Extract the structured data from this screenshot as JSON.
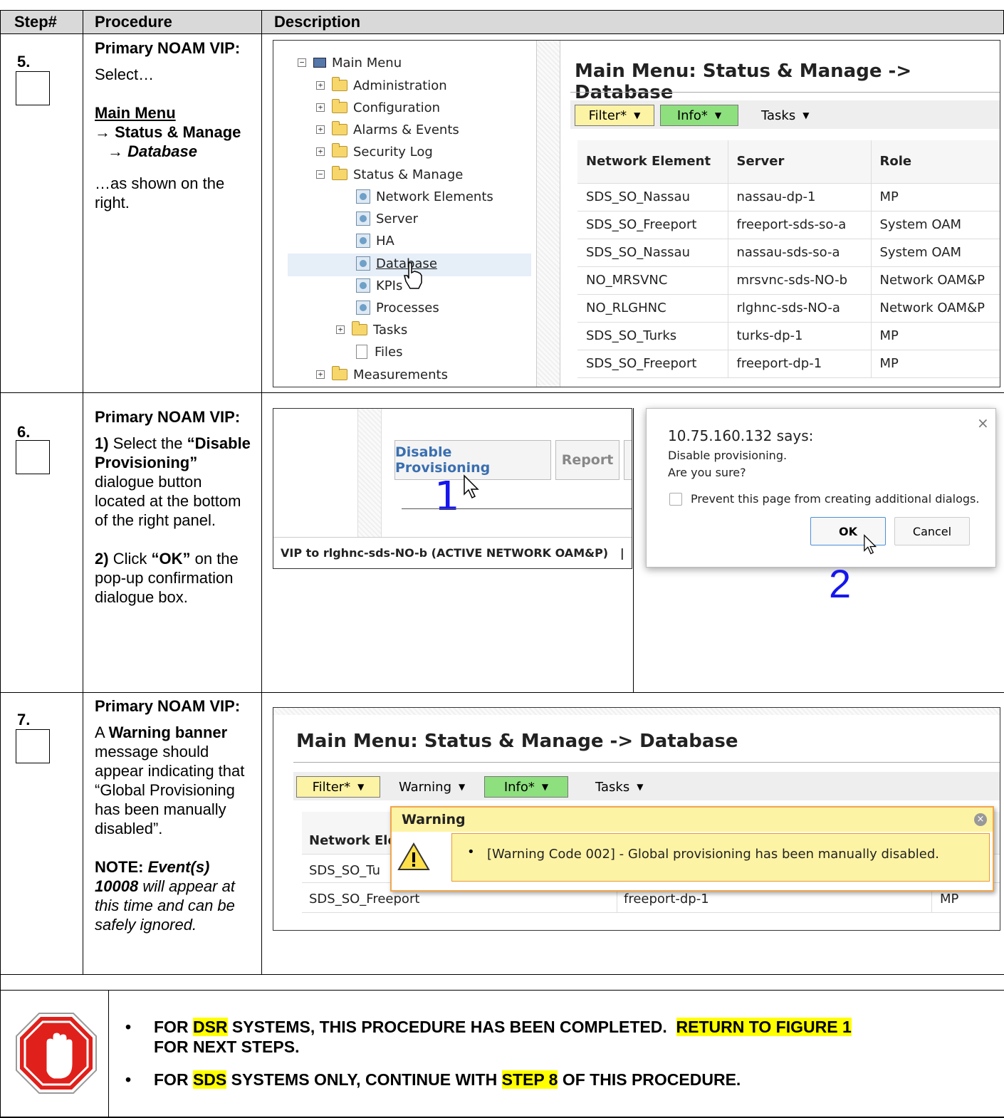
{
  "table": {
    "headers": [
      "Step#",
      "Procedure",
      "Description"
    ]
  },
  "step5": {
    "num": "5.",
    "proc_title": "Primary NOAM VIP:",
    "select": "Select…",
    "menu_path_1": "Main Menu",
    "menu_path_2": "→ Status & Manage",
    "menu_path_3": "→ Database",
    "shown": "…as shown on the right.",
    "tree": {
      "root": "Main Menu",
      "items": [
        "Administration",
        "Configuration",
        "Alarms & Events",
        "Security Log",
        "Status & Manage"
      ],
      "children": [
        "Network Elements",
        "Server",
        "HA",
        "Database",
        "KPIs",
        "Processes",
        "Tasks",
        "Files"
      ],
      "last": "Measurements"
    },
    "panel": {
      "title": "Main Menu: Status & Manage -> Database",
      "filter": "Filter*",
      "info": "Info*",
      "tasks": "Tasks",
      "columns": [
        "Network Element",
        "Server",
        "Role"
      ],
      "rows": [
        [
          "SDS_SO_Nassau",
          "nassau-dp-1",
          "MP"
        ],
        [
          "SDS_SO_Freeport",
          "freeport-sds-so-a",
          "System OAM"
        ],
        [
          "SDS_SO_Nassau",
          "nassau-sds-so-a",
          "System OAM"
        ],
        [
          "NO_MRSVNC",
          "mrsvnc-sds-NO-b",
          "Network OAM&P"
        ],
        [
          "NO_RLGHNC",
          "rlghnc-sds-NO-a",
          "Network OAM&P"
        ],
        [
          "SDS_SO_Turks",
          "turks-dp-1",
          "MP"
        ],
        [
          "SDS_SO_Freeport",
          "freeport-dp-1",
          "MP"
        ]
      ]
    }
  },
  "step6": {
    "num": "6.",
    "proc_title": "Primary NOAM VIP:",
    "p1_num": "1)",
    "p1_a": "Select the",
    "p1_b": "“Disable Provisioning”",
    "p1_c": "dialogue button located at the bottom of the right panel.",
    "p2_num": "2)",
    "p2_a": "Click",
    "p2_b": "“OK”",
    "p2_c": "on the pop-up confirmation dialogue box.",
    "left_ss": {
      "disable_btn": "Disable Provisioning",
      "report_btn": "Report",
      "marker": "1",
      "footer": "VIP to rlghnc-sds-NO-b (ACTIVE NETWORK OAM&P)   |   U"
    },
    "dialog": {
      "close": "×",
      "origin": "10.75.160.132 says:",
      "line1": "Disable provisioning.",
      "line2": "Are you sure?",
      "prevent": "Prevent this page from creating additional dialogs.",
      "ok": "OK",
      "cancel": "Cancel",
      "marker": "2"
    }
  },
  "step7": {
    "num": "7.",
    "proc_title": "Primary NOAM VIP:",
    "a1": "A",
    "a2": "Warning banner",
    "a3": "message should appear indicating that “Global Provisioning has been manually disabled”.",
    "note_label": "NOTE:",
    "note_bi": "Event(s) 10008",
    "note_rest": "will appear at this time and can be safely ignored.",
    "panel": {
      "title": "Main Menu: Status & Manage -> Database",
      "filter": "Filter*",
      "warning": "Warning",
      "info": "Info*",
      "tasks": "Tasks",
      "col_partial": "Network Ele",
      "row1_partial": "SDS_SO_Tu",
      "row2": [
        "SDS_SO_Freeport",
        "freeport-dp-1",
        "MP"
      ],
      "banner_title": "Warning",
      "banner_msg": "[Warning Code 002] - Global provisioning has been manually disabled."
    }
  },
  "stop": {
    "line1_a": "FOR ",
    "line1_hl1": "DSR",
    "line1_b": " SYSTEMS, THIS PROCEDURE HAS BEEN COMPLETED.  ",
    "line1_hl2": "RETURN TO FIGURE 1",
    "line1_c": "FOR NEXT STEPS.",
    "line2_a": "FOR ",
    "line2_hl1": "SDS",
    "line2_b": " SYSTEMS ONLY, CONTINUE WITH ",
    "line2_hl2": "STEP 8",
    "line2_c": " OF THIS PROCEDURE.",
    "colors": {
      "highlight": "#ffff00",
      "stop_red": "#e0201b"
    }
  }
}
